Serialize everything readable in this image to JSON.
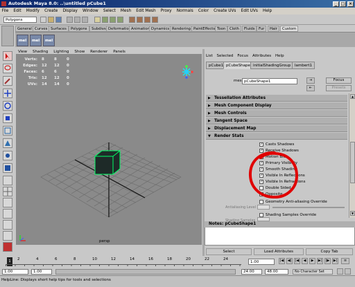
{
  "window": {
    "title": "Autodesk Maya 8.0: ..\\untitled    pCube1"
  },
  "menubar": [
    "File",
    "Edit",
    "Modify",
    "Create",
    "Display",
    "Window",
    "Select",
    "Mesh",
    "Edit Mesh",
    "Proxy",
    "Normals",
    "Color",
    "Create UVs",
    "Edit UVs",
    "Help"
  ],
  "statusline": {
    "mode": "Polygons"
  },
  "shelf": {
    "tabs": [
      "General",
      "Curves",
      "Surfaces",
      "Polygons",
      "Subdivs",
      "Deformation",
      "Animation",
      "Dynamics",
      "Rendering",
      "PaintEffects",
      "Toon",
      "Cloth",
      "Fluids",
      "Fur",
      "Hair",
      "Custom"
    ],
    "active": "Custom",
    "icons": [
      "mel",
      "mel",
      "mel"
    ]
  },
  "viewport": {
    "menu": [
      "View",
      "Shading",
      "Lighting",
      "Show",
      "Renderer",
      "Panels"
    ],
    "stats": [
      {
        "label": "Verts:",
        "a": "8",
        "b": "8",
        "c": "0"
      },
      {
        "label": "Edges:",
        "a": "12",
        "b": "12",
        "c": "0"
      },
      {
        "label": "Faces:",
        "a": "6",
        "b": "6",
        "c": "0"
      },
      {
        "label": "Tris:",
        "a": "12",
        "b": "12",
        "c": "0"
      },
      {
        "label": "UVs:",
        "a": "14",
        "b": "14",
        "c": "0"
      }
    ],
    "camera": "persp"
  },
  "attributeEditor": {
    "menu": [
      "List",
      "Selected",
      "Focus",
      "Attributes",
      "Help"
    ],
    "tabs": [
      "pCube1",
      "pCubeShape1",
      "initialShadingGroup",
      "lambert1"
    ],
    "meshLabel": "mesh:",
    "meshValue": "pCubeShape1",
    "focusBtn": "Focus",
    "presetsBtn": "Presets",
    "sections": [
      "Tessellation Attributes",
      "Mesh Component Display",
      "Mesh Controls",
      "Tangent Space",
      "Displacement Map",
      "Render Stats"
    ],
    "renderStats": [
      {
        "label": "Casts Shadows",
        "checked": true
      },
      {
        "label": "Receive Shadows",
        "checked": true
      },
      {
        "label": "Motion Blur",
        "checked": true
      },
      {
        "label": "Primary Visibility",
        "checked": true
      },
      {
        "label": "Smooth Shading",
        "checked": true
      },
      {
        "label": "Visible In Reflections",
        "checked": true
      },
      {
        "label": "Visible In Refractions",
        "checked": true
      },
      {
        "label": "Double Sided",
        "checked": false
      },
      {
        "label": "Opposite",
        "checked": false
      }
    ],
    "geoOverride": "Geometry Anti-aliasing Override",
    "aaLevel": "Antialiasing Level",
    "shadingOverride": "Shading Samples Override",
    "shadingSamples": "Shading Samples",
    "notes": "Notes: pCubeShape1",
    "buttons": [
      "Select",
      "Load Attributes",
      "Copy Tab"
    ]
  },
  "timeline": {
    "ticks": [
      "1",
      "2",
      "4",
      "6",
      "8",
      "10",
      "12",
      "14",
      "16",
      "18",
      "20",
      "22",
      "24"
    ],
    "current": "1.00"
  },
  "range": {
    "start": "1.00",
    "startInner": "1.00",
    "endInner": "24.00",
    "end": "48.00",
    "charset": "No Character Set"
  },
  "helpline": "HelpLine: Displays short help tips for tools and selections",
  "colors": {
    "annotation": "#e00000",
    "titlebar": "#0a246a",
    "cube": "#1e2a28",
    "cubeEdge": "#00ff66"
  }
}
